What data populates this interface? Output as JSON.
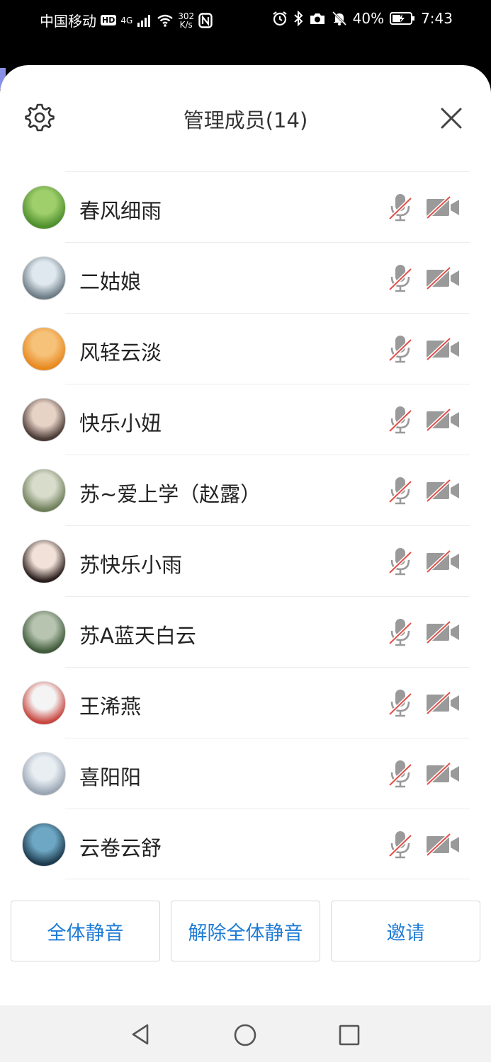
{
  "status_bar": {
    "carrier": "中国移动",
    "hd": "HD",
    "net": "4G",
    "speed_value": "302",
    "speed_unit": "K/s",
    "battery": "40%",
    "time": "7:43"
  },
  "header": {
    "title": "管理成员(14)"
  },
  "members": [
    {
      "name": "春风细雨",
      "avatar_colors": [
        "#9fcf6b",
        "#4e8f2e"
      ]
    },
    {
      "name": "二姑娘",
      "avatar_colors": [
        "#dfe8ee",
        "#6d7c86"
      ]
    },
    {
      "name": "风轻云淡",
      "avatar_colors": [
        "#f6c27a",
        "#e8891f"
      ]
    },
    {
      "name": "快乐小妞",
      "avatar_colors": [
        "#e7d2c6",
        "#4a3a35"
      ]
    },
    {
      "name": "苏~爱上学（赵露）",
      "avatar_colors": [
        "#d8dccb",
        "#6f7f5a"
      ]
    },
    {
      "name": "苏快乐小雨",
      "avatar_colors": [
        "#f1e1d8",
        "#2a1e1c"
      ]
    },
    {
      "name": "苏A蓝天白云",
      "avatar_colors": [
        "#b6c4b0",
        "#3f5a3a"
      ]
    },
    {
      "name": "王浠燕",
      "avatar_colors": [
        "#f4f4f4",
        "#c8463f"
      ]
    },
    {
      "name": "喜阳阳",
      "avatar_colors": [
        "#e9eef3",
        "#9aa6b4"
      ]
    },
    {
      "name": "云卷云舒",
      "avatar_colors": [
        "#6ea7c4",
        "#1d3a4d"
      ]
    }
  ],
  "buttons": {
    "mute_all": "全体静音",
    "unmute_all": "解除全体静音",
    "invite": "邀请"
  },
  "colors": {
    "accent": "#1e7bd6",
    "muted_red": "#e0504a",
    "icon_gray": "#9a9a9a"
  }
}
